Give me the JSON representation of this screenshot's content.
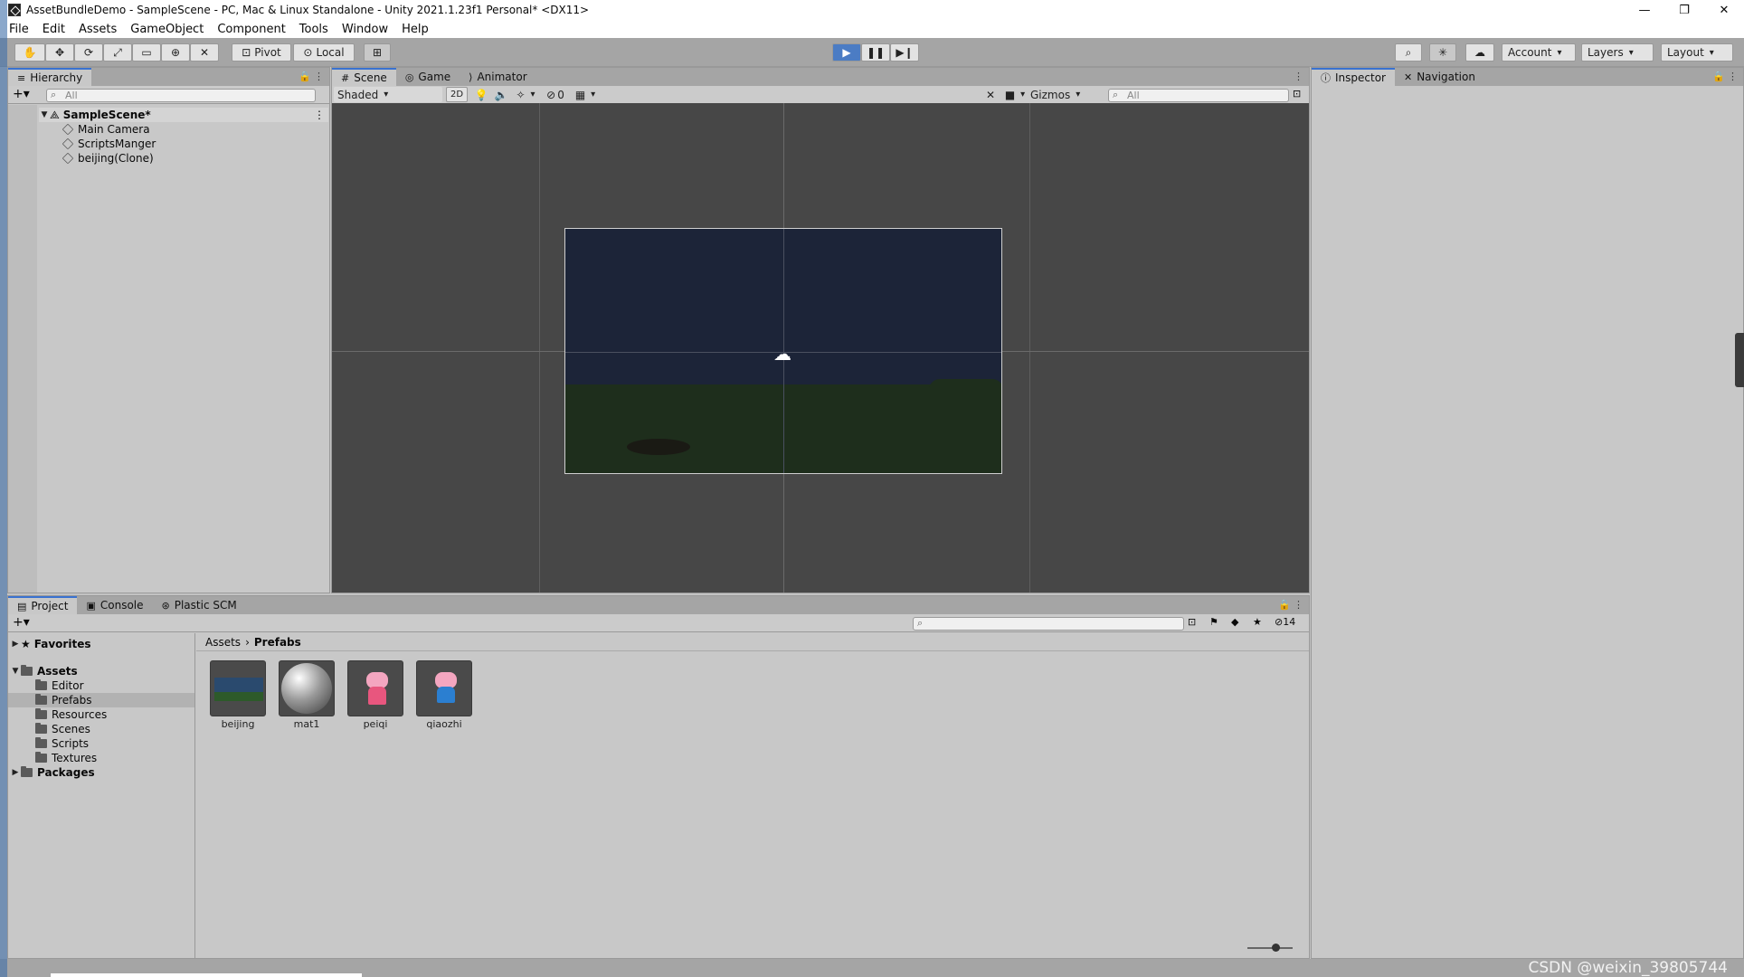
{
  "window": {
    "title": "AssetBundleDemo - SampleScene - PC, Mac & Linux Standalone - Unity 2021.1.23f1 Personal* <DX11>",
    "buttons": {
      "minimize": "—",
      "restore": "❐",
      "close": "✕"
    }
  },
  "menubar": {
    "items": [
      "File",
      "Edit",
      "Assets",
      "GameObject",
      "Component",
      "Tools",
      "Window",
      "Help"
    ]
  },
  "toolbar": {
    "pivot_label": "Pivot",
    "local_label": "Local",
    "account_label": "Account",
    "layers_label": "Layers",
    "layout_label": "Layout"
  },
  "hierarchy": {
    "tab_label": "Hierarchy",
    "search_placeholder": "All",
    "scene_name": "SampleScene*",
    "items": [
      "Main Camera",
      "ScriptsManger",
      "beijing(Clone)"
    ]
  },
  "scene": {
    "tabs": [
      "Scene",
      "Game",
      "Animator"
    ],
    "shading_mode": "Shaded",
    "mode_2d_label": "2D",
    "hidden_count": "0",
    "gizmos_label": "Gizmos",
    "search_placeholder": "All"
  },
  "inspector": {
    "tabs": [
      "Inspector",
      "Navigation"
    ]
  },
  "project": {
    "tabs": [
      "Project",
      "Console",
      "Plastic SCM"
    ],
    "favorites_label": "Favorites",
    "assets_label": "Assets",
    "folders": [
      "Editor",
      "Prefabs",
      "Resources",
      "Scenes",
      "Scripts",
      "Textures"
    ],
    "selected_folder": "Prefabs",
    "packages_label": "Packages",
    "breadcrumb": {
      "root": "Assets",
      "current": "Prefabs"
    },
    "hidden_count": "14",
    "assets": [
      {
        "name": "beijing"
      },
      {
        "name": "mat1"
      },
      {
        "name": "peiqi"
      },
      {
        "name": "qiaozhi"
      }
    ]
  },
  "watermark": "CSDN @weixin_39805744",
  "colors": {
    "panel_bg": "#c8c8c8",
    "toolbar_bg": "#a5a5a5",
    "scene_bg": "#474747",
    "accent_blue": "#3a72d0",
    "sky": "#1c2438",
    "ground": "#1e2e1c"
  }
}
